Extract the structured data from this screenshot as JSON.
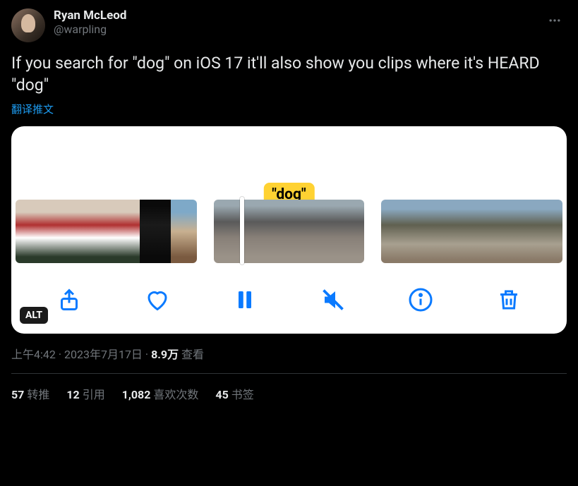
{
  "author": {
    "display_name": "Ryan McLeod",
    "handle": "@warpling"
  },
  "tweet_text": "If you search for \"dog\" on iOS 17 it'll also show you clips where it's HEARD \"dog\"",
  "translate_label": "翻译推文",
  "media": {
    "badge_text": "\"dog\"",
    "alt_label": "ALT"
  },
  "meta": {
    "time": "上午4:42",
    "date": "2023年7月17日",
    "views_count": "8.9万",
    "views_label": "查看"
  },
  "stats": {
    "retweets": {
      "count": "57",
      "label": "转推"
    },
    "quotes": {
      "count": "12",
      "label": "引用"
    },
    "likes": {
      "count": "1,082",
      "label": "喜欢次数"
    },
    "bookmarks": {
      "count": "45",
      "label": "书签"
    }
  }
}
